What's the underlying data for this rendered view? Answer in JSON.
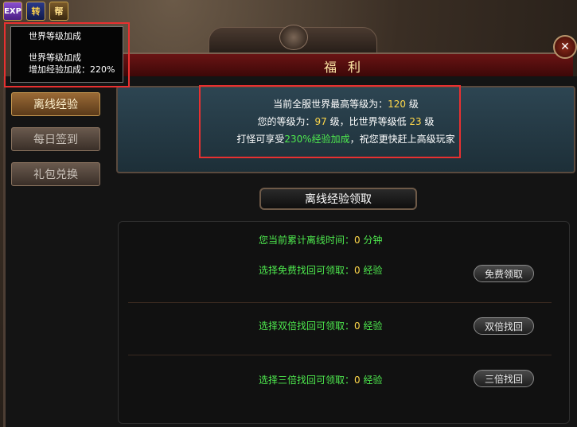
{
  "top_icons": [
    {
      "label": "EXP",
      "icon": "exp-icon"
    },
    {
      "label": "转",
      "icon": "zhuan-icon"
    },
    {
      "label": "帮",
      "icon": "bang-icon"
    }
  ],
  "tooltip": {
    "title": "世界等级加成",
    "line1": "世界等级加成",
    "line2_label": "增加经验加成：",
    "line2_value": "220%"
  },
  "window": {
    "title": "福利",
    "close_icon": "close-icon"
  },
  "sidebar": {
    "items": [
      {
        "label": "离线经验",
        "active": true
      },
      {
        "label": "每日签到",
        "active": false
      },
      {
        "label": "礼包兑换",
        "active": false
      }
    ]
  },
  "world_info": {
    "line1_prefix": "当前全服世界最高等级为：",
    "line1_value": "120",
    "line1_suffix": "级",
    "line2_prefix": "您的等级为：",
    "line2_value": "97",
    "line2_mid": "级，比世界等级低",
    "line2_value2": "23",
    "line2_suffix": "级",
    "line3_prefix": "打怪可享受",
    "line3_highlight": "230%经验加成",
    "line3_suffix": "，祝您更快赶上高级玩家"
  },
  "section": {
    "title": "离线经验领取"
  },
  "offline": {
    "time_label": "您当前累计离线时间：",
    "time_value": "0",
    "time_unit": "分钟",
    "rows": [
      {
        "label": "选择免费找回可领取：",
        "value": "0",
        "unit": "经验",
        "button": "免费领取"
      },
      {
        "label": "选择双倍找回可领取：",
        "value": "0",
        "unit": "经验",
        "button": "双倍找回"
      },
      {
        "label": "选择三倍找回可领取：",
        "value": "0",
        "unit": "经验",
        "button": "三倍找回"
      }
    ]
  },
  "colors": {
    "highlight_box": "#e83030",
    "green_text": "#4eea4e",
    "yellow_value": "#ffd84a"
  }
}
